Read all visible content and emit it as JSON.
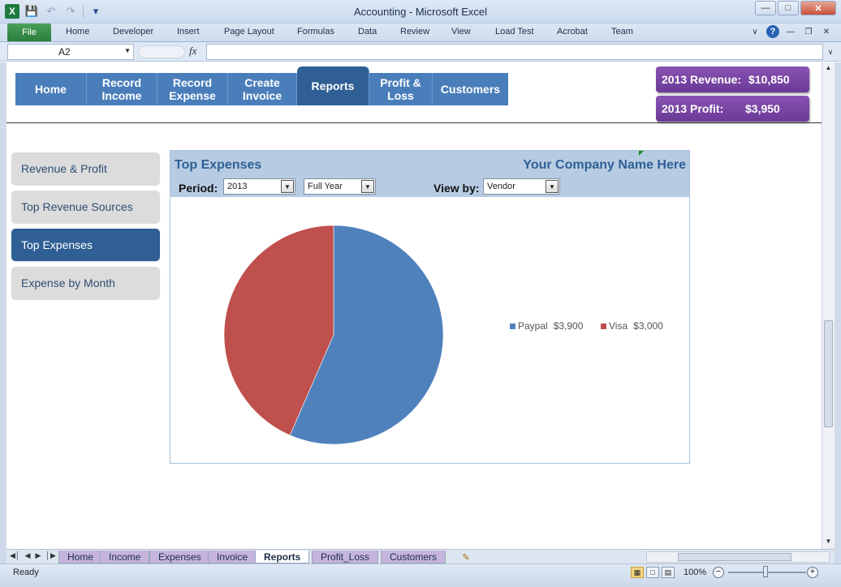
{
  "window": {
    "title": "Accounting  -  Microsoft Excel"
  },
  "qat": {
    "icons": [
      "excel-logo",
      "save-icon",
      "undo-icon",
      "redo-icon",
      "customize-qat-icon"
    ]
  },
  "ribbon": {
    "file": "File",
    "tabs": [
      "Home",
      "Developer",
      "Insert",
      "Page Layout",
      "Formulas",
      "Data",
      "Review",
      "View",
      "Load Test",
      "Acrobat",
      "Team"
    ]
  },
  "formula_bar": {
    "name_box": "A2",
    "fx": "fx",
    "value": ""
  },
  "nav": {
    "items": [
      {
        "label": "Home"
      },
      {
        "label": "Record Income"
      },
      {
        "label": "Record Expense"
      },
      {
        "label": "Create Invoice"
      },
      {
        "label": "Reports"
      },
      {
        "label": "Profit & Loss"
      },
      {
        "label": "Customers"
      }
    ],
    "active": "Reports"
  },
  "kpis": [
    {
      "label": "2013 Revenue:",
      "value": "$10,850"
    },
    {
      "label": "2013 Profit:",
      "value": "$3,950"
    }
  ],
  "side_nav": {
    "items": [
      "Revenue & Profit",
      "Top Revenue Sources",
      "Top Expenses",
      "Expense by Month"
    ],
    "active": "Top Expenses"
  },
  "report": {
    "title": "Top Expenses",
    "company": "Your Company Name Here",
    "period_label": "Period:",
    "year": "2013",
    "range": "Full Year",
    "view_by_label": "View by:",
    "view_by": "Vendor"
  },
  "chart_data": {
    "type": "pie",
    "categories": [
      "Paypal",
      "Visa"
    ],
    "values": [
      3900,
      3000
    ],
    "value_labels": [
      "$3,900",
      "$3,000"
    ],
    "colors": [
      "#4f81bd",
      "#c0504d"
    ],
    "legend_position": "right"
  },
  "sheet_tabs": {
    "items": [
      "Home",
      "Income",
      "Expenses",
      "Invoice",
      "Reports",
      "Profit_Loss",
      "Customers"
    ],
    "active": "Reports"
  },
  "status": {
    "ready": "Ready",
    "zoom": "100%"
  }
}
